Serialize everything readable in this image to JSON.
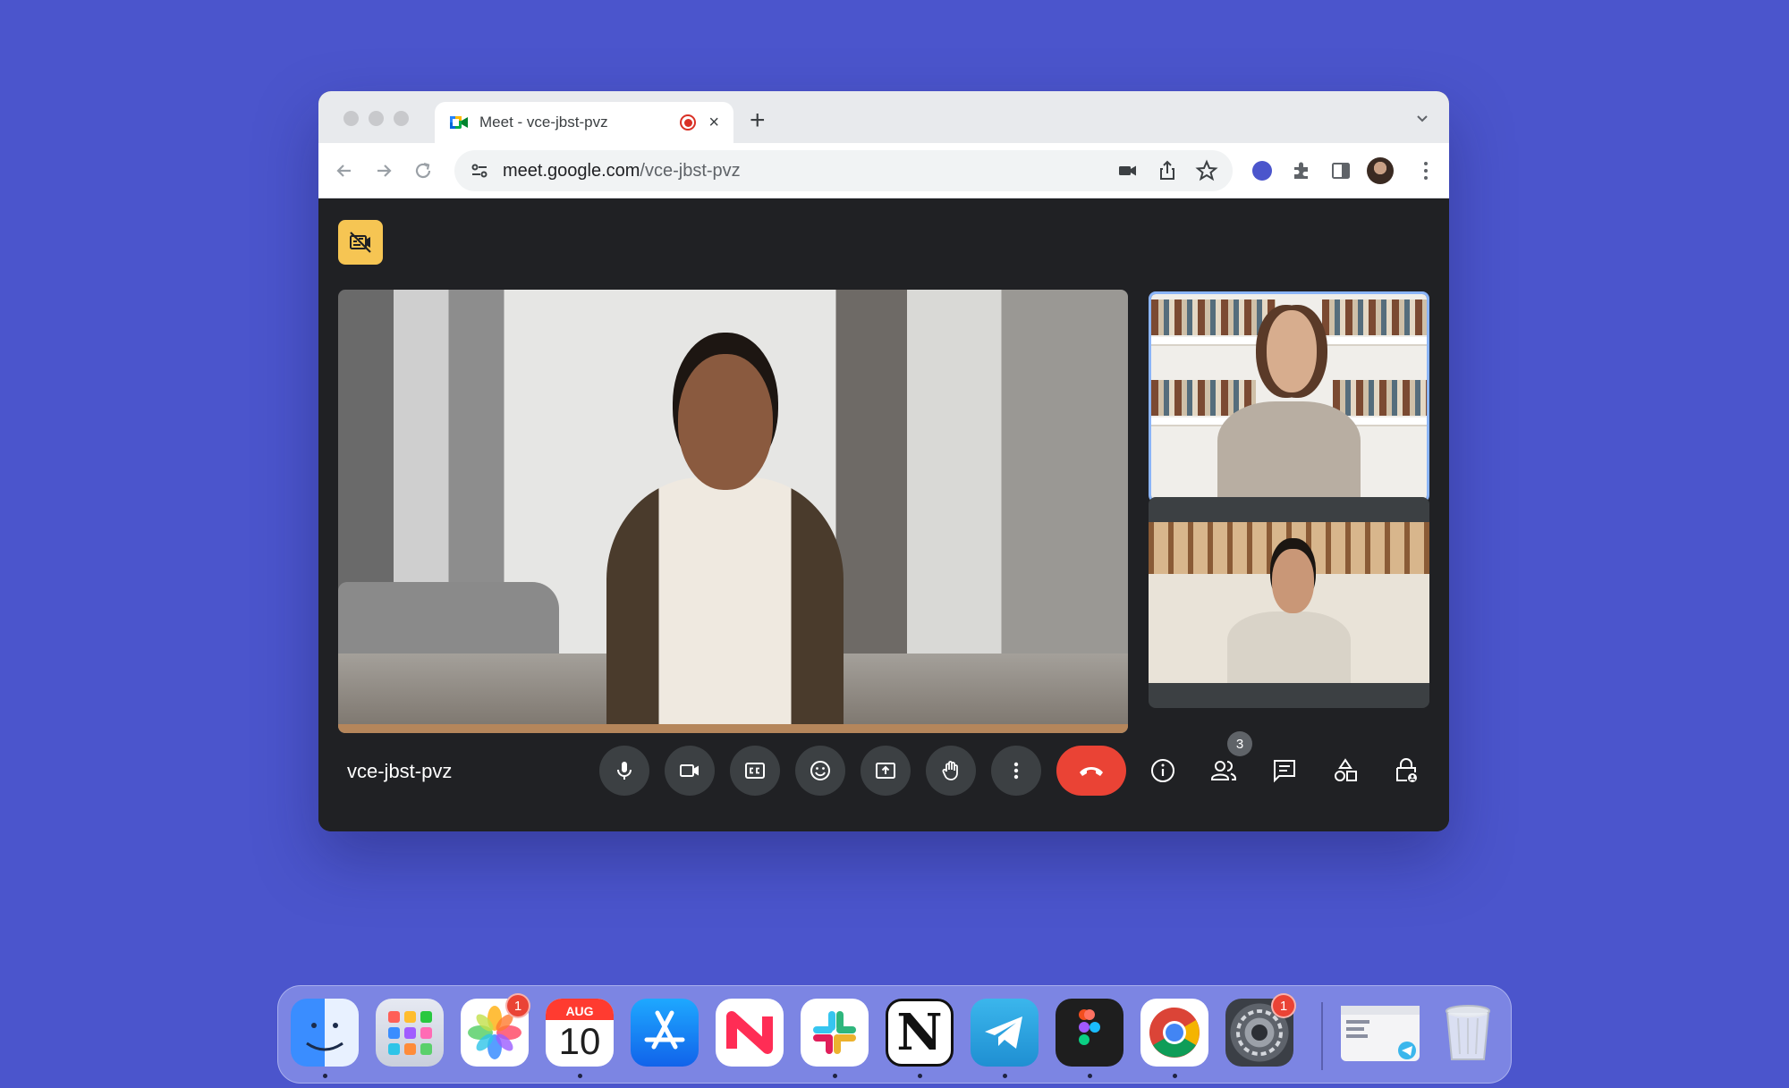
{
  "browser": {
    "tab_title": "Meet - vce-jbst-pvz",
    "tab_close": "×",
    "new_tab": "+",
    "url_host": "meet.google.com",
    "url_path": "/vce-jbst-pvz"
  },
  "meet": {
    "meeting_code": "vce-jbst-pvz",
    "people_count": "3",
    "colors": {
      "hangup": "#ea4335",
      "active_tile_border": "#8ab4f8",
      "badge": "#f6c553"
    }
  },
  "dock": {
    "photos_badge": "1",
    "calendar_month": "AUG",
    "calendar_day": "10",
    "notion_letter": "N",
    "settings_badge": "1"
  }
}
